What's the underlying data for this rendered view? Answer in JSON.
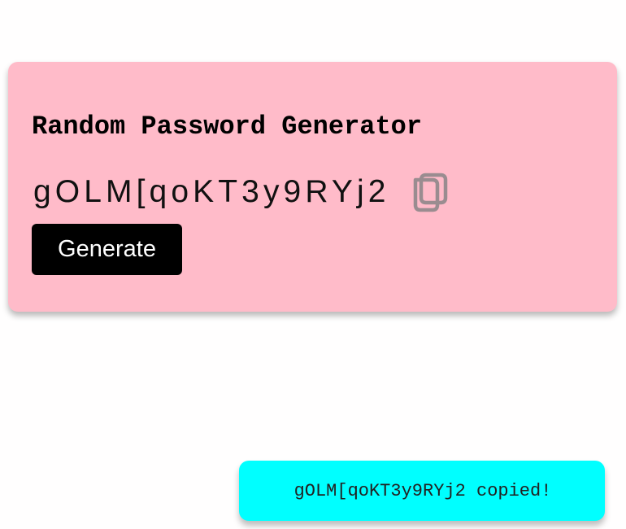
{
  "card": {
    "title": "Random Password Generator",
    "password": "gOLM[qoKT3y9RYj2",
    "copy_icon": "copy-icon",
    "generate_label": "Generate"
  },
  "toast": {
    "message": "gOLM[qoKT3y9RYj2 copied!"
  },
  "colors": {
    "card_background": "#ffbbc9",
    "button_background": "#000000",
    "toast_background": "#00ffff"
  }
}
